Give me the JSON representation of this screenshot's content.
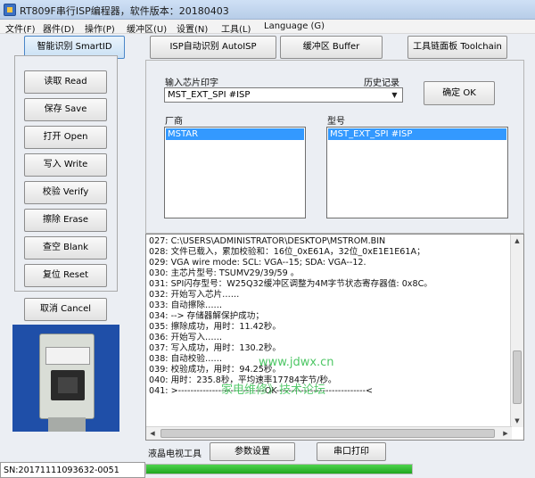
{
  "window": {
    "title": "RT809F串行ISP编程器，软件版本：20180403"
  },
  "menu": [
    "文件(F)",
    "器件(D)",
    "操作(P)",
    "缓冲区(U)",
    "设置(N)",
    "工具(L)",
    "Language (G)"
  ],
  "toolbar": {
    "smartid": "智能识别 SmartID",
    "autoisp": "ISP自动识别 AutoISP",
    "buffer": "缓冲区 Buffer",
    "toolchain": "工具链面板 Toolchain"
  },
  "sidebar": {
    "read": "读取 Read",
    "save": "保存 Save",
    "open": "打开 Open",
    "write": "写入 Write",
    "verify": "校验 Verify",
    "erase": "擦除 Erase",
    "blank": "查空 Blank",
    "reset": "复位 Reset",
    "cancel": "取消 Cancel"
  },
  "chip": {
    "input_label": "输入芯片印字",
    "history_label": "历史记录",
    "input_value": "MST_EXT_SPI #ISP",
    "ok": "确定 OK",
    "vendor_label": "厂商",
    "vendor_selected": "MSTAR",
    "model_label": "型号",
    "model_selected": "MST_EXT_SPI #ISP"
  },
  "log": [
    "027: C:\\USERS\\ADMINISTRATOR\\DESKTOP\\MSTROM.BIN",
    "028: 文件已载入，累加校验和：16位_0xE61A，32位_0xE1E1E61A；",
    "029: VGA wire mode: SCL: VGA--15; SDA: VGA--12.",
    "030: 主芯片型号: TSUMV29/39/59 。",
    "031: SPI闪存型号：W25Q32缓冲区调整为4M字节状态寄存器值: 0x8C。",
    "032: 开始写入芯片……",
    "033: 自动擦除……",
    "034: --> 存储器解保护成功；",
    "035: 擦除成功，用时：11.42秒。",
    "036: 开始写入……",
    "037: 写入成功，用时：130.2秒。",
    "038: 自动校验……",
    "039: 校验成功，用时：94.25秒。",
    "040: 用时：235.8秒，平均速率17784字节/秒。",
    "041: >----------------------------OK-----------------------------<"
  ],
  "bottom": {
    "tv_tools": "液晶电视工具",
    "params": "参数设置",
    "serial": "串口打印",
    "progress": 1.0
  },
  "status": {
    "sn": "SN:20171111093632-0051"
  },
  "watermark": {
    "url": "www.jdwx.cn",
    "forum": "家电维修》技术论坛"
  },
  "colors": {
    "selection": "#3399ff",
    "progress": "#1fa61f",
    "device_bg": "#1f4fa8",
    "watermark": "#2ebd4a"
  }
}
